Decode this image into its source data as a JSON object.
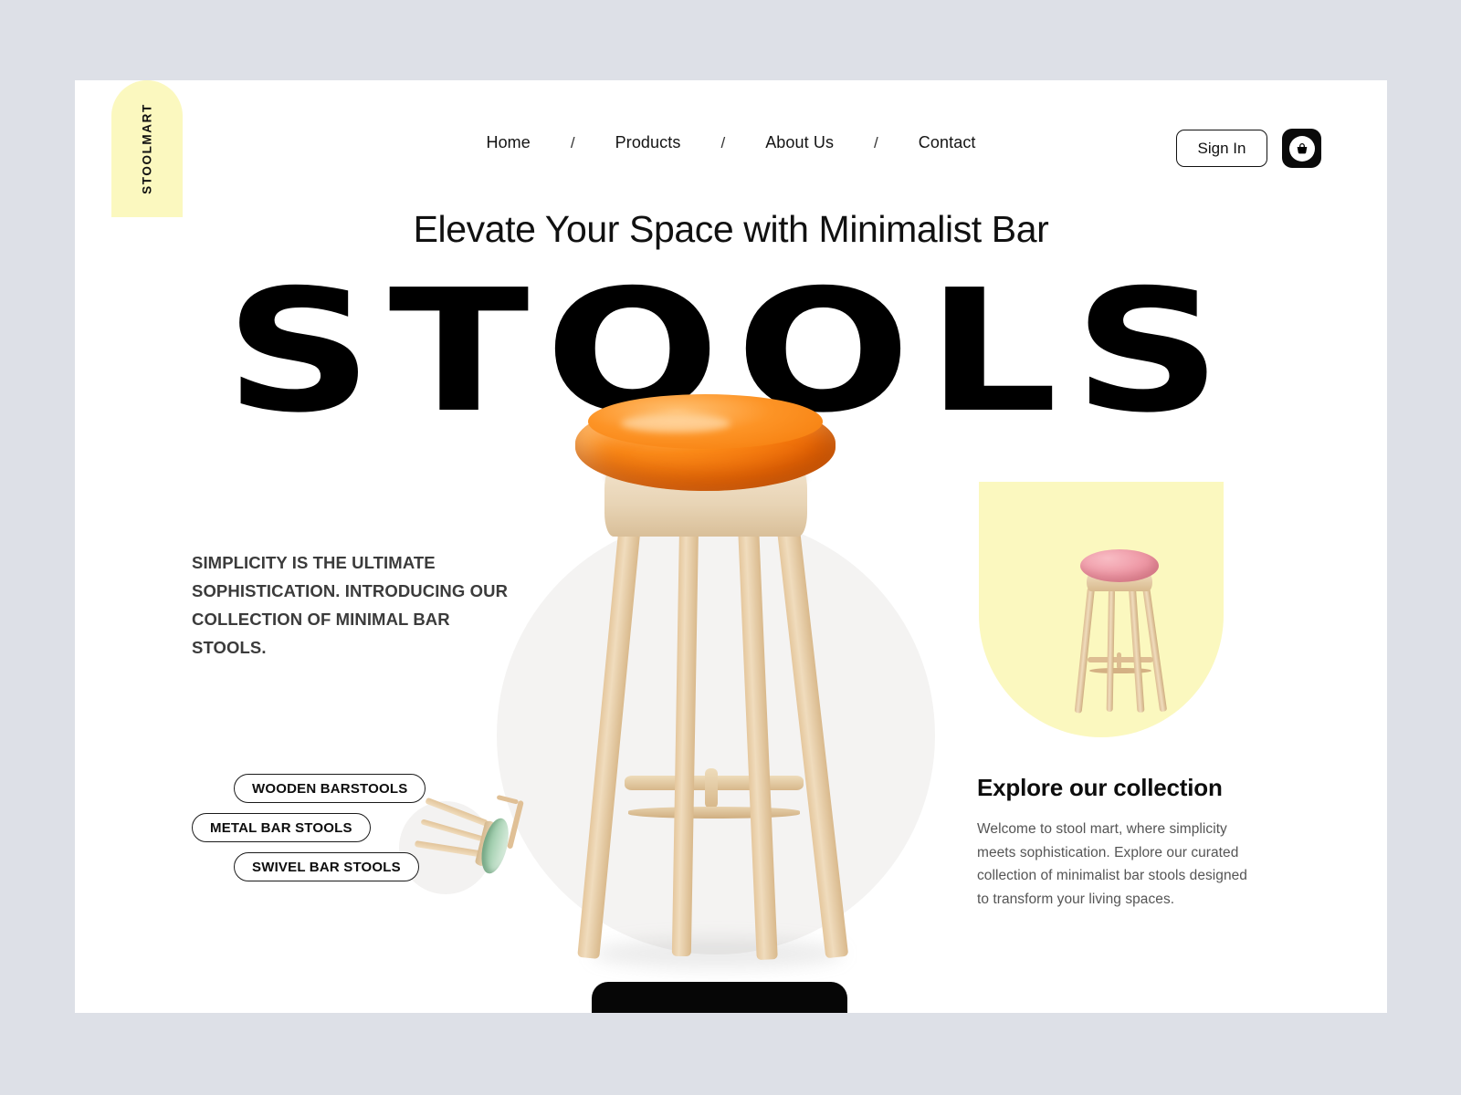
{
  "brand": {
    "logo_text": "STOOLMART",
    "logo_bg": "#FBF8BF"
  },
  "nav": {
    "items": [
      {
        "label": "Home"
      },
      {
        "label": "Products"
      },
      {
        "label": "About Us"
      },
      {
        "label": "Contact"
      }
    ],
    "separator": "/"
  },
  "header": {
    "sign_in_label": "Sign In",
    "cart_icon": "shopping-basket-icon"
  },
  "hero": {
    "headline": "Elevate Your Space with Minimalist Bar",
    "wordmark": "STOOLS",
    "tagline": "SIMPLICITY IS THE ULTIMATE SOPHISTICATION. INTRODUCING OUR COLLECTION OF MINIMAL BAR STOOLS.",
    "main_product_image": "orange-seat-wooden-bar-stool",
    "accent_circle_color": "#F4F3F2"
  },
  "categories": [
    {
      "label": "WOODEN BARSTOOLS"
    },
    {
      "label": "METAL BAR STOOLS"
    },
    {
      "label": "SWIVEL BAR STOOLS"
    }
  ],
  "mini_product": {
    "image": "tilted-green-seat-stool"
  },
  "showcase": {
    "card_bg": "#FBF8BF",
    "image": "pink-seat-wooden-bar-stool"
  },
  "explore": {
    "title": "Explore our collection",
    "body": "Welcome to stool mart, where simplicity meets sophistication. Explore our curated collection of minimalist bar stools designed to transform your living spaces."
  },
  "cta": {
    "label": ""
  },
  "theme": {
    "page_bg": "#FFFFFF",
    "outer_bg": "#DDE0E7",
    "text_dark": "#111111",
    "text_muted": "#555555",
    "accent_yellow": "#FBF8BF",
    "accent_orange": "#F47A09",
    "black": "#0A0A0A"
  }
}
